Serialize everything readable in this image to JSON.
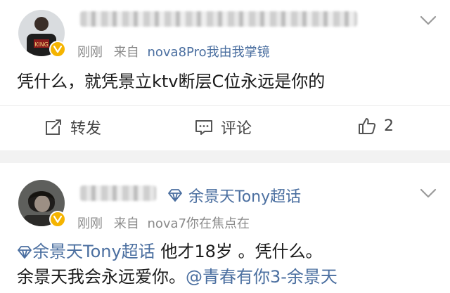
{
  "post1": {
    "time": "刚刚",
    "source_prefix": "来自",
    "source": "nova8Pro我由我掌镜",
    "content": "凭什么，就凭景立ktv断层C位永远是你的",
    "actions": {
      "repost_label": "转发",
      "comment_label": "评论",
      "like_count": "2"
    },
    "avatar_text": "KING"
  },
  "post2": {
    "topic_tag": "余景天Tony超话",
    "time": "刚刚",
    "source_prefix": "来自",
    "source": "nova7你在焦点在",
    "content_line1_topic": "余景天Tony超话",
    "content_line1_text": " 他才18岁 。凭什么。",
    "content_line2_text": "余景天我会永远爱你。",
    "content_line2_mention": "@青春有你3-余景天"
  },
  "icons": {
    "chevron": "chevron-down-icon",
    "repost": "repost-icon",
    "comment": "comment-icon",
    "like": "thumbs-up-icon",
    "vip": "vip-badge-icon",
    "supertopic": "diamond-icon"
  },
  "colors": {
    "link": "#4b6fa0",
    "badge": "#f5b400",
    "band": "#f2f2f2"
  }
}
